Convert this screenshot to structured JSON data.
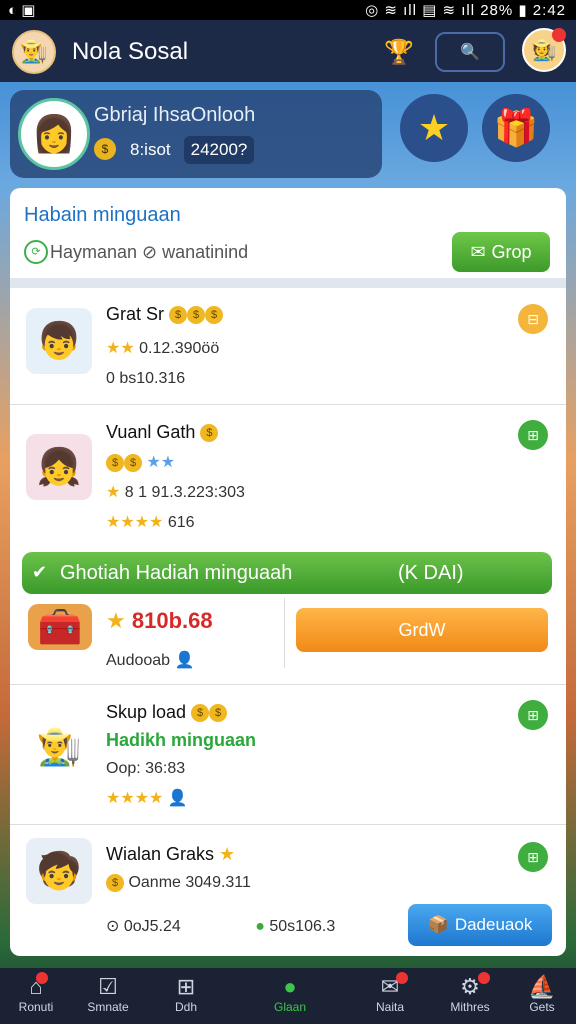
{
  "status": {
    "left": "◐ ▣",
    "right": "◎ ≋ ıll ▤ ≋ ıll 28% ▮ 2:42"
  },
  "appbar": {
    "title": "Nola Sosal"
  },
  "profile": {
    "name": "Gbriaj IhsaOnlooh",
    "stat": "8:isot",
    "value": "24200?"
  },
  "panel": {
    "title": "Habain minguaan",
    "subtitle": "Haymanan  ⊘ wanatinind",
    "group_button": "Grop"
  },
  "rows": [
    {
      "title": "Grat Sr",
      "line1": "0.12.390öö",
      "line2": "0 bs10.316"
    },
    {
      "title": "Vuanl Gath",
      "line1": "8 1 91.3.223:303",
      "line2": "616"
    },
    {
      "title": "Skup load",
      "line1": "Hadikh minguaan",
      "line2": "Oop: 36:83"
    },
    {
      "title": "Wialan Graks",
      "line1": "Oanme 3049.311",
      "line2": "0oJ5.24",
      "line3": "50s106.3"
    }
  ],
  "banner": {
    "text": "Ghotiah Hadiah minguaah",
    "right": "(K DAI)"
  },
  "offer": {
    "amount": "810b.68",
    "label": "Audooab",
    "button": "GrdW"
  },
  "blue_button": "Dadeuaok",
  "nav": [
    {
      "label": "Ronuti"
    },
    {
      "label": "Smnate"
    },
    {
      "label": "Ddh"
    },
    {
      "label": "Glaan"
    },
    {
      "label": "Naita"
    },
    {
      "label": "Mithres"
    },
    {
      "label": "Gets"
    }
  ]
}
